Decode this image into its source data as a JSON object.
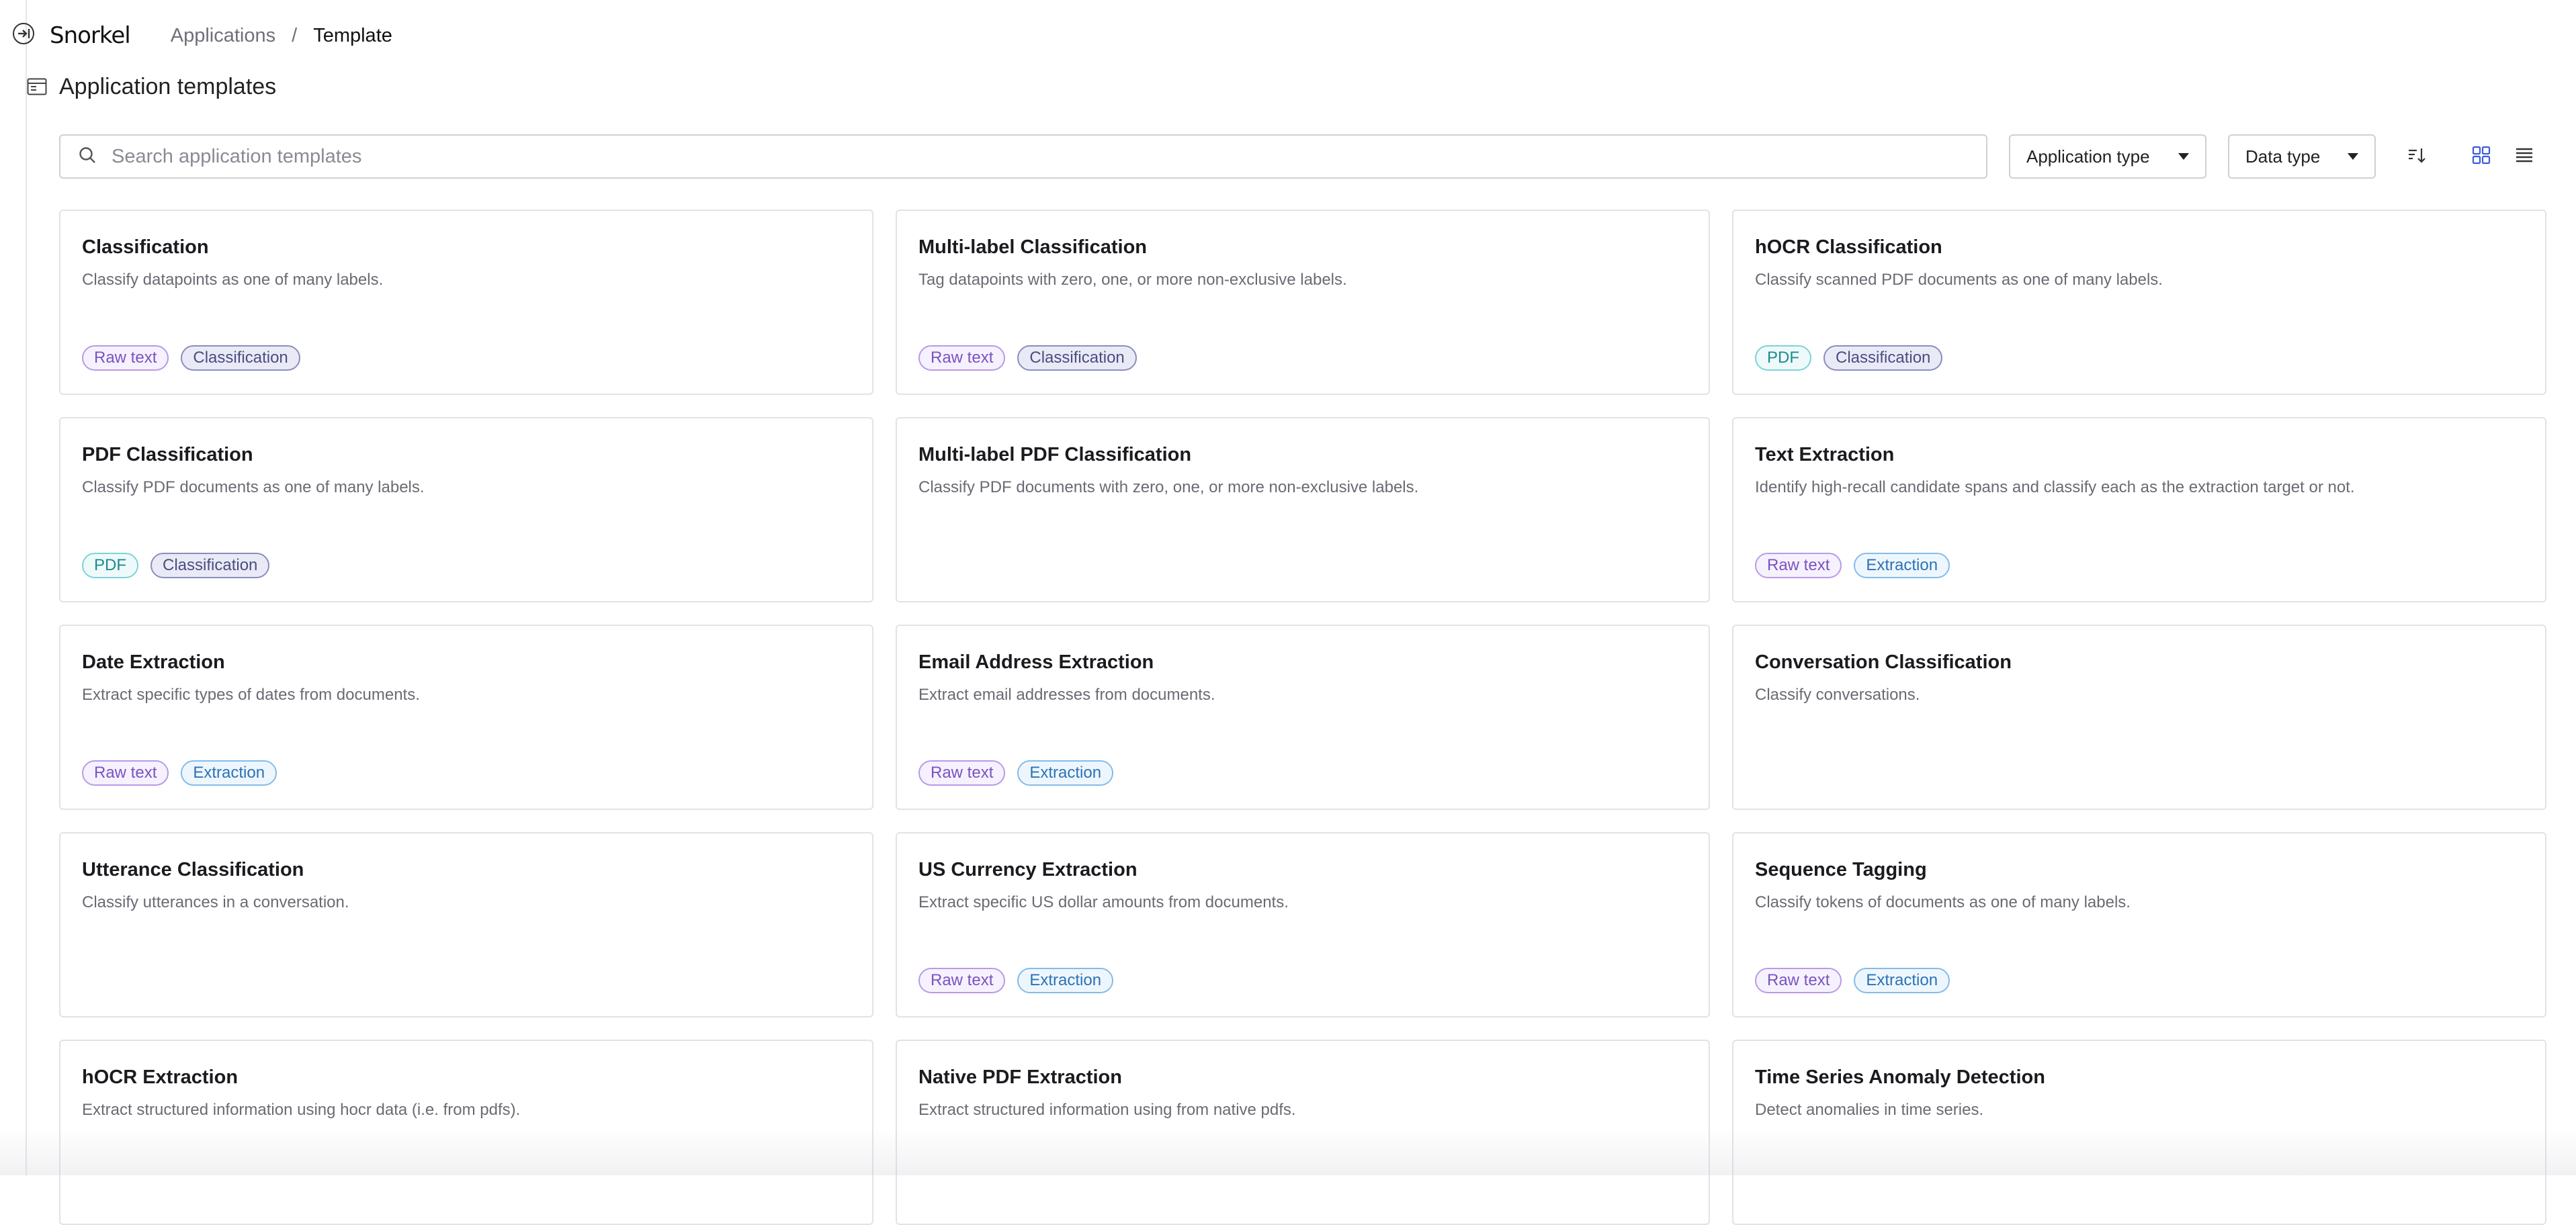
{
  "app": {
    "logo": "Snorkel"
  },
  "breadcrumb": {
    "parent": "Applications",
    "separator": "/",
    "current": "Template"
  },
  "header": {
    "title": "Application templates",
    "icon": "template-list-icon"
  },
  "toolbar": {
    "search_placeholder": "Search application templates",
    "application_type_label": "Application type",
    "data_type_label": "Data type",
    "sort_icon": "sort-icon",
    "grid_view_icon": "grid-view-icon",
    "list_view_icon": "list-view-icon",
    "active_view": "grid"
  },
  "colors": {
    "raw_text_tag": "#7a52c2",
    "pdf_tag": "#1b8a8f",
    "classification_tag": "#4a4d80",
    "extraction_tag": "#2a73b8",
    "active_view_icon": "#3b5bdb"
  },
  "cards": [
    {
      "title": "Classification",
      "description": "Classify datapoints as one of many labels.",
      "tags": [
        {
          "label": "Raw text",
          "kind": "raw"
        },
        {
          "label": "Classification",
          "kind": "classification"
        }
      ]
    },
    {
      "title": "Multi-label Classification",
      "description": "Tag datapoints with zero, one, or more non-exclusive labels.",
      "tags": [
        {
          "label": "Raw text",
          "kind": "raw"
        },
        {
          "label": "Classification",
          "kind": "classification"
        }
      ]
    },
    {
      "title": "hOCR Classification",
      "description": "Classify scanned PDF documents as one of many labels.",
      "tags": [
        {
          "label": "PDF",
          "kind": "pdf"
        },
        {
          "label": "Classification",
          "kind": "classification"
        }
      ]
    },
    {
      "title": "PDF Classification",
      "description": "Classify PDF documents as one of many labels.",
      "tags": [
        {
          "label": "PDF",
          "kind": "pdf"
        },
        {
          "label": "Classification",
          "kind": "classification"
        }
      ]
    },
    {
      "title": "Multi-label PDF Classification",
      "description": "Classify PDF documents with zero, one, or more non-exclusive labels.",
      "tags": []
    },
    {
      "title": "Text Extraction",
      "description": "Identify high-recall candidate spans and classify each as the extraction target or not.",
      "tags": [
        {
          "label": "Raw text",
          "kind": "raw"
        },
        {
          "label": "Extraction",
          "kind": "extraction"
        }
      ]
    },
    {
      "title": "Date Extraction",
      "description": "Extract specific types of dates from documents.",
      "tags": [
        {
          "label": "Raw text",
          "kind": "raw"
        },
        {
          "label": "Extraction",
          "kind": "extraction"
        }
      ]
    },
    {
      "title": "Email Address Extraction",
      "description": "Extract email addresses from documents.",
      "tags": [
        {
          "label": "Raw text",
          "kind": "raw"
        },
        {
          "label": "Extraction",
          "kind": "extraction"
        }
      ]
    },
    {
      "title": "Conversation Classification",
      "description": "Classify conversations.",
      "tags": []
    },
    {
      "title": "Utterance Classification",
      "description": "Classify utterances in a conversation.",
      "tags": []
    },
    {
      "title": "US Currency Extraction",
      "description": "Extract specific US dollar amounts from documents.",
      "tags": [
        {
          "label": "Raw text",
          "kind": "raw"
        },
        {
          "label": "Extraction",
          "kind": "extraction"
        }
      ]
    },
    {
      "title": "Sequence Tagging",
      "description": "Classify tokens of documents as one of many labels.",
      "tags": [
        {
          "label": "Raw text",
          "kind": "raw"
        },
        {
          "label": "Extraction",
          "kind": "extraction"
        }
      ]
    },
    {
      "title": "hOCR Extraction",
      "description": "Extract structured information using hocr data (i.e. from pdfs).",
      "tags": []
    },
    {
      "title": "Native PDF Extraction",
      "description": "Extract structured information using from native pdfs.",
      "tags": []
    },
    {
      "title": "Time Series Anomaly Detection",
      "description": "Detect anomalies in time series.",
      "tags": []
    }
  ]
}
